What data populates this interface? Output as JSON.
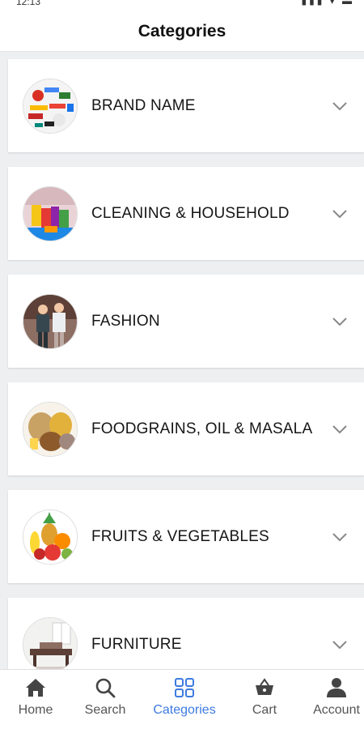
{
  "status_bar": {
    "time": "12:13",
    "icons": "▮▮▮ ▾ ▬"
  },
  "header": {
    "title": "Categories"
  },
  "categories": [
    {
      "label": "BRAND NAME",
      "icon": "brand-logos-thumbnail"
    },
    {
      "label": "CLEANING & HOUSEHOLD",
      "icon": "cleaning-household-thumbnail"
    },
    {
      "label": "FASHION",
      "icon": "fashion-thumbnail"
    },
    {
      "label": "FOODGRAINS, OIL & MASALA",
      "icon": "foodgrains-thumbnail"
    },
    {
      "label": "FRUITS & VEGETABLES",
      "icon": "fruits-vegetables-thumbnail"
    },
    {
      "label": "FURNITURE",
      "icon": "furniture-thumbnail"
    }
  ],
  "bottom_nav": {
    "active": "Categories",
    "active_color": "#3d7be0",
    "items": [
      {
        "label": "Home",
        "icon": "home-icon"
      },
      {
        "label": "Search",
        "icon": "search-icon"
      },
      {
        "label": "Categories",
        "icon": "grid-icon"
      },
      {
        "label": "Cart",
        "icon": "basket-icon"
      },
      {
        "label": "Account",
        "icon": "person-icon"
      }
    ]
  }
}
